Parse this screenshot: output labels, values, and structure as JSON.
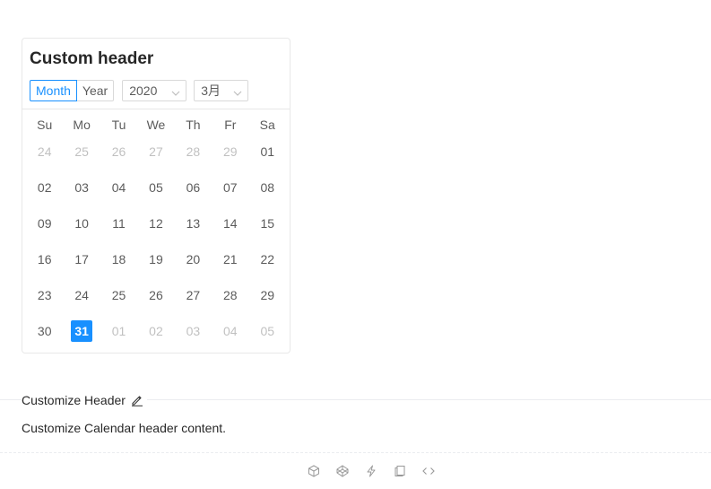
{
  "calendar": {
    "title": "Custom header",
    "type_options": [
      "Month",
      "Year"
    ],
    "selected_type": "Month",
    "year_value": "2020",
    "month_value": "3月",
    "weekdays": [
      "Su",
      "Mo",
      "Tu",
      "We",
      "Th",
      "Fr",
      "Sa"
    ],
    "weeks": [
      [
        {
          "d": "24",
          "o": true
        },
        {
          "d": "25",
          "o": true
        },
        {
          "d": "26",
          "o": true
        },
        {
          "d": "27",
          "o": true
        },
        {
          "d": "28",
          "o": true
        },
        {
          "d": "29",
          "o": true
        },
        {
          "d": "01",
          "o": false
        }
      ],
      [
        {
          "d": "02",
          "o": false
        },
        {
          "d": "03",
          "o": false
        },
        {
          "d": "04",
          "o": false
        },
        {
          "d": "05",
          "o": false
        },
        {
          "d": "06",
          "o": false
        },
        {
          "d": "07",
          "o": false
        },
        {
          "d": "08",
          "o": false
        }
      ],
      [
        {
          "d": "09",
          "o": false
        },
        {
          "d": "10",
          "o": false
        },
        {
          "d": "11",
          "o": false
        },
        {
          "d": "12",
          "o": false
        },
        {
          "d": "13",
          "o": false
        },
        {
          "d": "14",
          "o": false
        },
        {
          "d": "15",
          "o": false
        }
      ],
      [
        {
          "d": "16",
          "o": false
        },
        {
          "d": "17",
          "o": false
        },
        {
          "d": "18",
          "o": false
        },
        {
          "d": "19",
          "o": false
        },
        {
          "d": "20",
          "o": false
        },
        {
          "d": "21",
          "o": false
        },
        {
          "d": "22",
          "o": false
        }
      ],
      [
        {
          "d": "23",
          "o": false
        },
        {
          "d": "24",
          "o": false
        },
        {
          "d": "25",
          "o": false
        },
        {
          "d": "26",
          "o": false
        },
        {
          "d": "27",
          "o": false
        },
        {
          "d": "28",
          "o": false
        },
        {
          "d": "29",
          "o": false
        }
      ],
      [
        {
          "d": "30",
          "o": false
        },
        {
          "d": "31",
          "o": false,
          "selected": true
        },
        {
          "d": "01",
          "o": true
        },
        {
          "d": "02",
          "o": true
        },
        {
          "d": "03",
          "o": true
        },
        {
          "d": "04",
          "o": true
        },
        {
          "d": "05",
          "o": true
        }
      ]
    ]
  },
  "meta": {
    "title": "Customize Header",
    "description": "Customize Calendar header content."
  },
  "actions": [
    "codesandbox-icon",
    "codepen-icon",
    "thunderbolt-icon",
    "snippets-icon",
    "code-icon"
  ],
  "colors": {
    "primary": "#1890ff",
    "border": "#e8e8e8",
    "disabled_text": "rgba(0,0,0,0.25)"
  }
}
